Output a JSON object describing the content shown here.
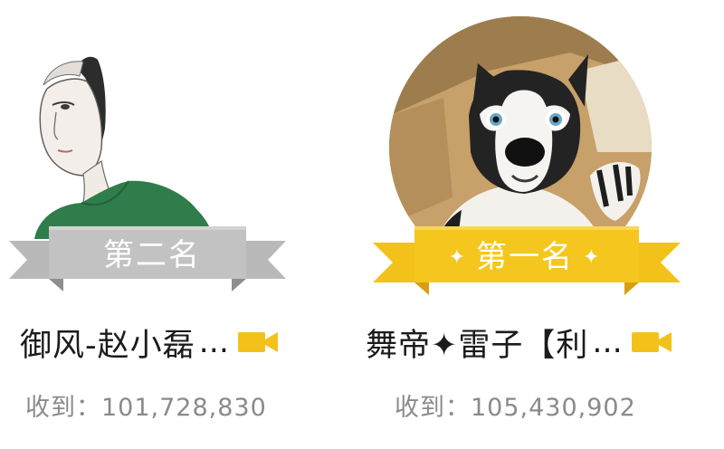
{
  "colors": {
    "silver_ribbon": "#b9b9b9",
    "silver_ribbon_dark": "#8e8e8e",
    "gold_ribbon": "#f2c21a",
    "gold_ribbon_dark": "#d79f0c",
    "video_icon": "#f2c21a",
    "name_text": "#1b1b1b",
    "received_text": "#8a8a8a"
  },
  "cards": {
    "second": {
      "rank_label": "第二名",
      "avatar_icon": "sketch-portrait-avatar",
      "name": "御风-赵小磊",
      "name_ellipsis": "...",
      "video_icon": "video-camera-icon",
      "received_prefix": "收到：",
      "received_value": "101,728,830"
    },
    "first": {
      "rank_label": "第一名",
      "rank_star": "✦",
      "avatar_icon": "husky-dog-avatar",
      "name": "舞帝✦雷子【利",
      "name_ellipsis": "...",
      "video_icon": "video-camera-icon",
      "received_prefix": "收到：",
      "received_value": "105,430,902"
    }
  }
}
